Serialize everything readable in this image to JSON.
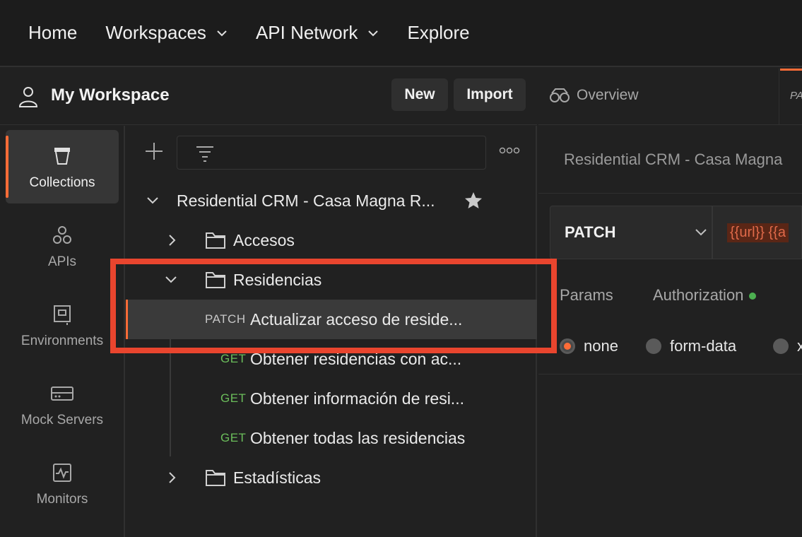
{
  "topnav": {
    "items": [
      {
        "label": "Home",
        "has_dropdown": false
      },
      {
        "label": "Workspaces",
        "has_dropdown": true
      },
      {
        "label": "API Network",
        "has_dropdown": true
      },
      {
        "label": "Explore",
        "has_dropdown": false
      }
    ]
  },
  "workspace": {
    "title": "My Workspace",
    "new_label": "New",
    "import_label": "Import"
  },
  "rail": {
    "items": [
      {
        "label": "Collections",
        "icon": "collections-icon",
        "active": true
      },
      {
        "label": "APIs",
        "icon": "apis-icon",
        "active": false
      },
      {
        "label": "Environments",
        "icon": "environments-icon",
        "active": false
      },
      {
        "label": "Mock Servers",
        "icon": "mock-servers-icon",
        "active": false
      },
      {
        "label": "Monitors",
        "icon": "monitors-icon",
        "active": false
      }
    ]
  },
  "tree": {
    "collection": "Residential CRM - Casa Magna R...",
    "folders": {
      "accesos": "Accesos",
      "residencias": "Residencias",
      "estadisticas": "Estadísticas"
    },
    "requests": [
      {
        "method": "PATCH",
        "name": "Actualizar acceso de reside...",
        "selected": true
      },
      {
        "method": "GET",
        "name": "Obtener residencias con ac...",
        "selected": false
      },
      {
        "method": "GET",
        "name": "Obtener información de resi...",
        "selected": false
      },
      {
        "method": "GET",
        "name": "Obtener todas las residencias",
        "selected": false
      }
    ]
  },
  "right": {
    "overview_tab": "Overview",
    "partial_tab": "PA",
    "request_title": "Residential CRM - Casa Magna",
    "method": "PATCH",
    "url": "{{url}} {{a",
    "subtabs": [
      "Params",
      "Authorization"
    ],
    "body_options": [
      "none",
      "form-data",
      "x"
    ],
    "body_selected": "none"
  },
  "colors": {
    "accent": "#ff6c37",
    "get_method": "#6bbd5b",
    "highlight": "#e9452e"
  }
}
